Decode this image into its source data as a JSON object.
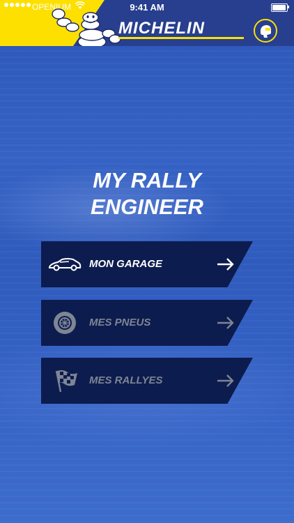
{
  "status_bar": {
    "carrier": "OPENIUM",
    "time": "9:41 AM"
  },
  "header": {
    "brand": "MICHELIN",
    "mascot_icon": "michelin-man-icon",
    "account_icon": "rally-driver-helmet-icon"
  },
  "main": {
    "title_line1": "MY RALLY",
    "title_line2": "ENGINEER"
  },
  "menu": [
    {
      "label": "MON GARAGE",
      "icon": "car-icon",
      "state": "active"
    },
    {
      "label": "MES PNEUS",
      "icon": "tire-icon",
      "state": "disabled"
    },
    {
      "label": "MES RALLYES",
      "icon": "checkered-flag-icon",
      "state": "disabled"
    }
  ],
  "colors": {
    "brand_yellow": "#fde000",
    "header_blue": "#273f8e",
    "button_navy": "#0d1c4e",
    "disabled_text": "#7e8594"
  }
}
